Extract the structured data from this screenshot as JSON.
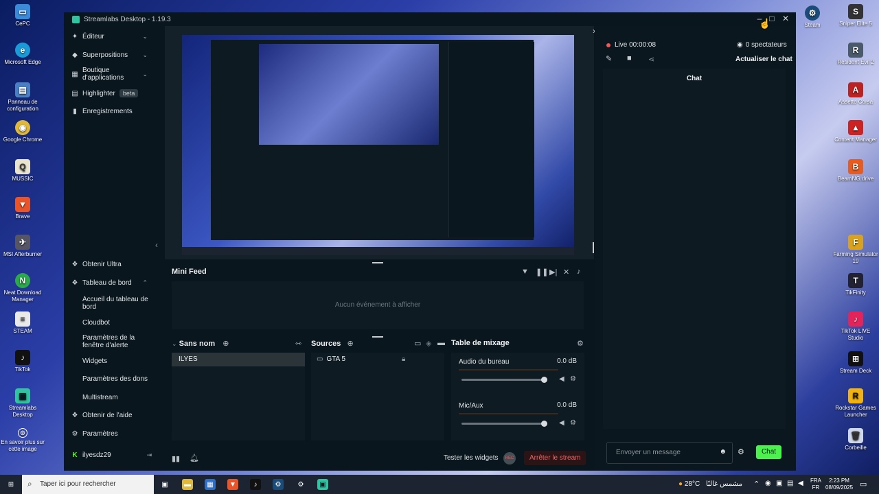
{
  "desktop": {
    "left_icons": [
      "CePC",
      "Microsoft Edge",
      "Panneau de configuration",
      "Google Chrome",
      "MUSSIC",
      "Brave",
      "MSI Afterburner",
      "Neat Download Manager",
      "STEAM",
      "TikTok",
      "Streamlabs Desktop",
      "En savoir plus sur cette image"
    ],
    "right_icons": [
      "Steam",
      "Sniper Elite 5",
      "Resident Evil 2",
      "Assetto Corsa",
      "Content Manager",
      "BeamNG.drive",
      "Farming Simulator 19",
      "TikFinity",
      "TikTok LIVE Studio",
      "Stream Deck",
      "Rockstar Games Launcher",
      "Corbeille"
    ]
  },
  "window": {
    "title": "Streamlabs Desktop - 1.19.3"
  },
  "sidebar": {
    "editor": "Éditeur",
    "overlays": "Superpositions",
    "app_store": "Boutique d'applications",
    "highlighter": "Highlighter",
    "beta": "beta",
    "recordings": "Enregistrements",
    "get_ultra": "Obtenir Ultra",
    "dashboard": "Tableau de bord",
    "dashboard_items": [
      "Accueil du tableau de bord",
      "Cloudbot",
      "Paramètres de la fenêtre d'alerte",
      "Widgets",
      "Paramètres des dons",
      "Multistream"
    ],
    "help": "Obtenir de l'aide",
    "settings": "Paramètres",
    "user": "ilyesdz29"
  },
  "minifeed": {
    "title": "Mini Feed",
    "empty": "Aucun événement à afficher"
  },
  "scenes": {
    "title": "Sans nom",
    "items": [
      "ILYES"
    ]
  },
  "sources": {
    "title": "Sources",
    "items": [
      "GTA 5"
    ]
  },
  "mixer": {
    "title": "Table de mixage",
    "channels": [
      {
        "name": "Audio du bureau",
        "db": "0.0 dB",
        "level": 1.0
      },
      {
        "name": "Mic/Aux",
        "db": "0.0 dB",
        "level": 1.0
      }
    ]
  },
  "footer": {
    "test_widgets": "Tester les widgets",
    "rec": "REC",
    "stop": "Arrêter le stream"
  },
  "chat": {
    "live": "Live 00:00:08",
    "viewers": "0 spectateurs",
    "refresh": "Actualiser le chat",
    "title": "Chat",
    "placeholder": "Envoyer un message",
    "send": "Chat"
  },
  "taskbar": {
    "search": "Taper ici pour rechercher",
    "weather": "28°C",
    "weather_text": "مشمس غالبًا",
    "lang1": "FRA",
    "lang2": "FR",
    "time": "2:23 PM",
    "date": "08/09/2025"
  },
  "colors": {
    "accent": "#80f5d2",
    "live": "#f25858",
    "send": "#4cf24c"
  }
}
